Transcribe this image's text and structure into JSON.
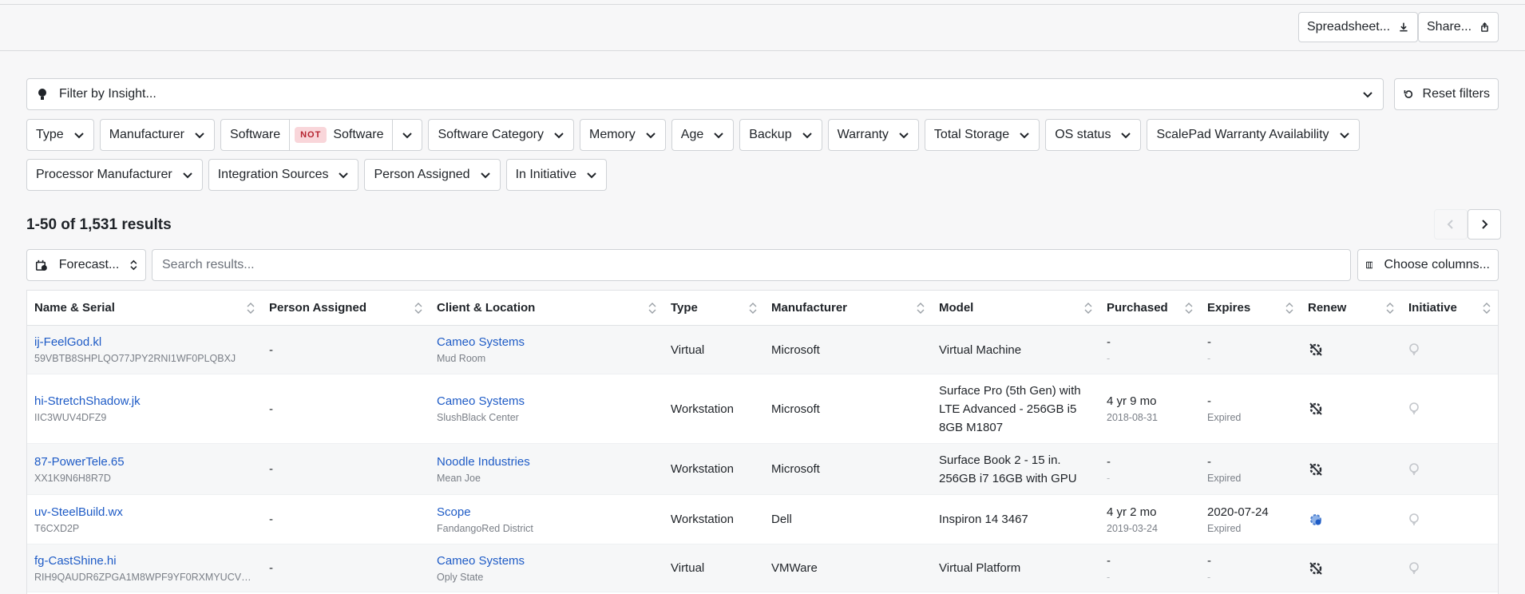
{
  "header": {
    "spreadsheet_label": "Spreadsheet...",
    "share_label": "Share..."
  },
  "insight_filter": {
    "label": "Filter by Insight..."
  },
  "reset_filters_label": "Reset filters",
  "filters_row1": [
    "Type",
    "Manufacturer",
    "Software",
    "Software",
    "Software Category",
    "Memory",
    "Age",
    "Backup",
    "Warranty",
    "Total Storage",
    "OS status",
    "ScalePad Warranty Availability"
  ],
  "not_badge": "NOT",
  "filters_row2": [
    "Processor Manufacturer",
    "Integration Sources",
    "Person Assigned",
    "In Initiative"
  ],
  "results": {
    "summary": "1-50 of 1,531 results"
  },
  "forecast_label": "Forecast...",
  "search": {
    "placeholder": "Search results..."
  },
  "choose_columns_label": "Choose columns...",
  "columns": [
    "Name & Serial",
    "Person Assigned",
    "Client & Location",
    "Type",
    "Manufacturer",
    "Model",
    "Purchased",
    "Expires",
    "Renew",
    "Initiative"
  ],
  "rows": [
    {
      "name": "ij-FeelGod.kl",
      "serial": "59VBTB8SHPLQO77JPY2RNI1WF0PLQBXJ",
      "person": "-",
      "client": "Cameo Systems",
      "location": "Mud Room",
      "type": "Virtual",
      "manufacturer": "Microsoft",
      "model": "Virtual Machine",
      "purchased": "-",
      "purchased_sub": "-",
      "expires": "-",
      "expires_sub": "-",
      "renew_icon": "renew-disabled-icon",
      "initiative_icon": "lightbulb-icon"
    },
    {
      "name": "hi-StretchShadow.jk",
      "serial": "IIC3WUV4DFZ9",
      "person": "-",
      "client": "Cameo Systems",
      "location": "SlushBlack Center",
      "type": "Workstation",
      "manufacturer": "Microsoft",
      "model": "Surface Pro (5th Gen) with LTE Advanced - 256GB i5 8GB M1807",
      "purchased": "4 yr 9 mo",
      "purchased_sub": "2018-08-31",
      "expires": "-",
      "expires_sub": "Expired",
      "renew_icon": "renew-disabled-icon",
      "initiative_icon": "lightbulb-icon"
    },
    {
      "name": "87-PowerTele.65",
      "serial": "XX1K9N6H8R7D",
      "person": "-",
      "client": "Noodle Industries",
      "location": "Mean Joe",
      "type": "Workstation",
      "manufacturer": "Microsoft",
      "model": "Surface Book 2 - 15 in. 256GB i7 16GB with GPU",
      "purchased": "-",
      "purchased_sub": "-",
      "expires": "-",
      "expires_sub": "Expired",
      "renew_icon": "renew-disabled-icon",
      "initiative_icon": "lightbulb-icon"
    },
    {
      "name": "uv-SteelBuild.wx",
      "serial": "T6CXD2P",
      "person": "-",
      "client": "Scope",
      "location": "FandangoRed District",
      "type": "Workstation",
      "manufacturer": "Dell",
      "model": "Inspiron 14 3467",
      "purchased": "4 yr 2 mo",
      "purchased_sub": "2019-03-24",
      "expires": "2020-07-24",
      "expires_sub": "Expired",
      "renew_icon": "renew-available-icon",
      "initiative_icon": "lightbulb-icon"
    },
    {
      "name": "fg-CastShine.hi",
      "serial": "RIH9QAUDR6ZPGA1M8WPF9YF0RXMYUCV1...",
      "person": "-",
      "client": "Cameo Systems",
      "location": "Oply State",
      "type": "Virtual",
      "manufacturer": "VMWare",
      "model": "Virtual Platform",
      "purchased": "-",
      "purchased_sub": "-",
      "expires": "-",
      "expires_sub": "-",
      "renew_icon": "renew-disabled-icon",
      "initiative_icon": "lightbulb-icon"
    }
  ]
}
